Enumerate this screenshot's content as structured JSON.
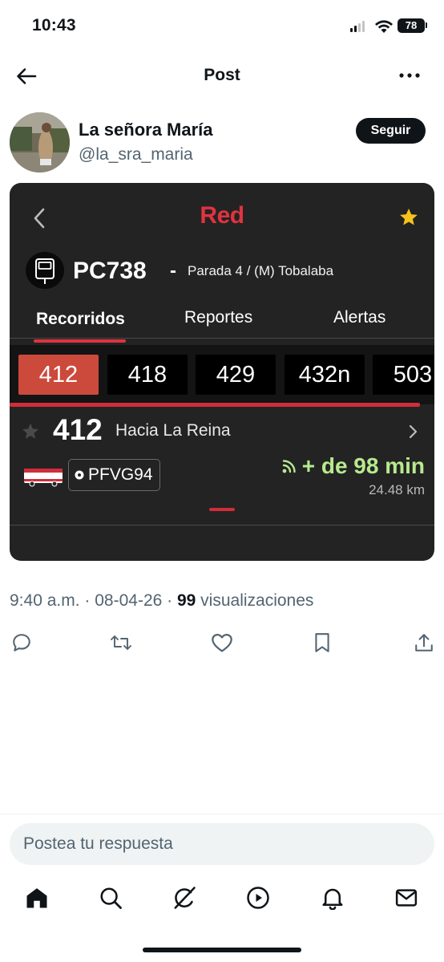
{
  "status_bar": {
    "time": "10:43",
    "battery": "78"
  },
  "header": {
    "title": "Post",
    "back_icon": "arrow-left-icon",
    "more_icon": "more-horizontal-icon"
  },
  "author": {
    "name": "La señora María",
    "handle": "@la_sra_maria",
    "follow_label": "Seguir"
  },
  "media": {
    "app_logo": "Red",
    "stop": {
      "code": "PC738",
      "separator": "-",
      "name": "Parada 4 / (M) Tobalaba"
    },
    "tabs": [
      {
        "label": "Recorridos",
        "active": true
      },
      {
        "label": "Reportes",
        "active": false
      },
      {
        "label": "Alertas",
        "active": false
      }
    ],
    "routes": [
      "412",
      "418",
      "429",
      "432n",
      "503"
    ],
    "active_route": "412",
    "card": {
      "route": "412",
      "destination": "Hacia La Reina",
      "plate": "PFVG94",
      "eta": "+ de 98 min",
      "distance": "24.48 km"
    },
    "colors": {
      "brand_red": "#e0333f",
      "active_chip": "#cc4a3b",
      "eta_green": "#b7ea8e",
      "star_yellow": "#f6c21b"
    }
  },
  "meta": {
    "time": "9:40 a.m.",
    "date": "08-04-26",
    "views_count": "99",
    "views_label": "visualizaciones",
    "separator": " · "
  },
  "actions": [
    "reply-icon",
    "repost-icon",
    "like-icon",
    "bookmark-icon",
    "share-icon"
  ],
  "reply": {
    "placeholder": "Postea tu respuesta"
  },
  "bottom_nav": [
    "home-icon",
    "search-icon",
    "grok-icon",
    "video-icon",
    "notifications-icon",
    "messages-icon"
  ]
}
